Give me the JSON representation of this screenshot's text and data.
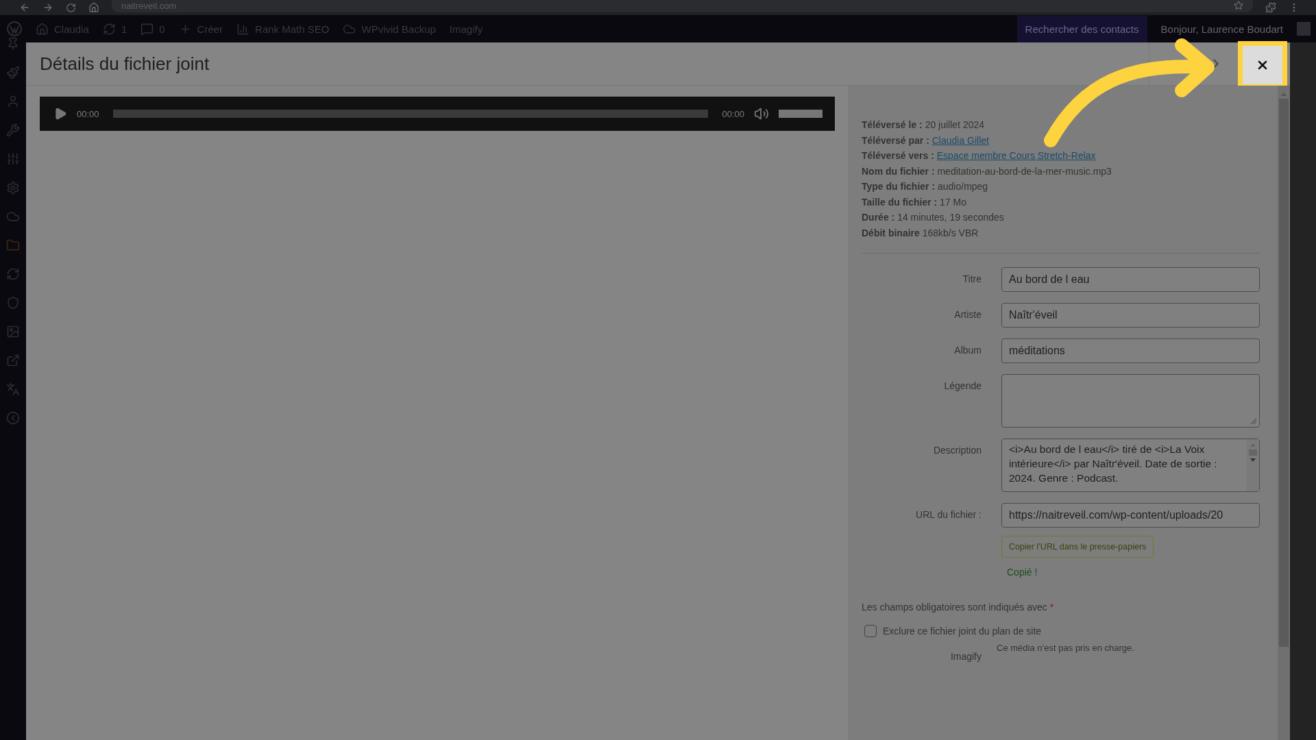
{
  "browser": {
    "url": "naitreveil.com"
  },
  "admin_bar": {
    "items": [
      {
        "kind": "home",
        "label": "Claudia"
      },
      {
        "kind": "updates",
        "label": "1"
      },
      {
        "kind": "comments",
        "label": "0"
      },
      {
        "kind": "new",
        "label": "Créer"
      },
      {
        "kind": "seo",
        "label": "Rank Math SEO"
      },
      {
        "kind": "backup",
        "label": "WPvivid Backup"
      },
      {
        "kind": "plain",
        "label": "Imagify"
      }
    ],
    "search_label": "Rechercher des contacts",
    "greeting": "Bonjour, Laurence Boudart"
  },
  "modal": {
    "title": "Détails du fichier joint"
  },
  "player": {
    "current_time": "00:00",
    "duration": "00:00",
    "progress": {
      "level": 0
    },
    "volume": {
      "level": 1
    }
  },
  "details": [
    {
      "label": "Téléversé le :",
      "value": "20 juillet 2024",
      "kind": "text"
    },
    {
      "label": "Téléversé par :",
      "value": "Claudia Gillet",
      "kind": "link"
    },
    {
      "label": "Téléversé vers :",
      "value": "Espace membre Cours Stretch-Relax",
      "kind": "link"
    },
    {
      "label": "Nom du fichier :",
      "value": "meditation-au-bord-de-la-mer-music.mp3",
      "kind": "text"
    },
    {
      "label": "Type du fichier :",
      "value": "audio/mpeg",
      "kind": "text"
    },
    {
      "label": "Taille du fichier :",
      "value": "17 Mo",
      "kind": "text"
    },
    {
      "label": "Durée :",
      "value": "14 minutes, 19 secondes",
      "kind": "text"
    },
    {
      "label": "Débit binaire",
      "value": "168kb/s VBR",
      "kind": "text"
    }
  ],
  "fields": [
    {
      "label": "Titre",
      "kind": "input",
      "value": "Au bord de l eau"
    },
    {
      "label": "Artiste",
      "kind": "input",
      "value": "Naîtr'éveil"
    },
    {
      "label": "Album",
      "kind": "input",
      "value": "méditations"
    },
    {
      "label": "Légende",
      "kind": "textarea"
    },
    {
      "label": "Description",
      "kind": "scroll_textarea",
      "value": "<i>Au bord de l eau</i> tiré de <i>La Voix intérieure</i> par Naîtr'éveil. Date de sortie : 2024. Genre : Podcast."
    },
    {
      "label": "URL du fichier :",
      "kind": "readonly",
      "value": "https://naitreveil.com/wp-content/uploads/20"
    }
  ],
  "copy_button": "Copier l’URL dans le presse-papiers",
  "copied_message": "Copié !",
  "required_note": {
    "text": "Les champs obligatoires sont indiqués avec",
    "mark": "*"
  },
  "sitemap_checkbox": {
    "label": "Exclure ce fichier joint du plan de site",
    "checked": false
  },
  "imagify": {
    "label": "Imagify",
    "note": "Ce média n’est pas pris en charge."
  }
}
